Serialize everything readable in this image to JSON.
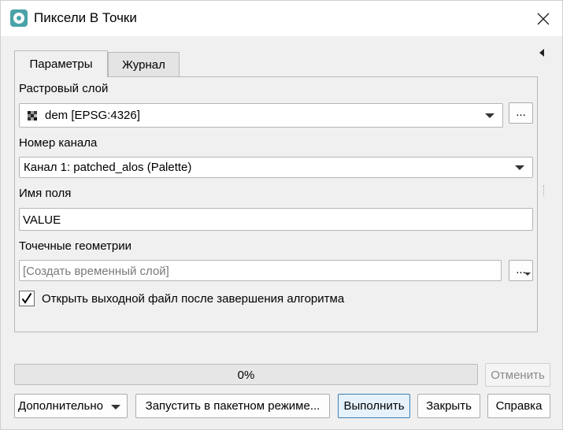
{
  "window": {
    "title": "Пиксели В Точки"
  },
  "tabs": [
    {
      "label": "Параметры",
      "active": true
    },
    {
      "label": "Журнал",
      "active": false
    }
  ],
  "params": {
    "raster_layer": {
      "label": "Растровый слой",
      "value": "dem [EPSG:4326]",
      "browse_label": "..."
    },
    "band": {
      "label": "Номер канала",
      "value": "Канал 1: patched_alos (Palette)"
    },
    "field_name": {
      "label": "Имя поля",
      "value": "VALUE"
    },
    "output": {
      "label": "Точечные геометрии",
      "placeholder": "[Создать временный слой]",
      "browse_label": "..."
    },
    "open_after": {
      "label": "Открыть выходной файл после завершения алгоритма",
      "checked": true
    }
  },
  "progress": {
    "value": 0,
    "text": "0%"
  },
  "buttons": {
    "cancel": "Отменить",
    "advanced": "Дополнительно",
    "batch": "Запустить в пакетном режиме...",
    "run": "Выполнить",
    "close": "Закрыть",
    "help": "Справка"
  },
  "colors": {
    "accent": "#3c7fb1",
    "progress_fill": "#06b025",
    "app_icon": "#4aa3a8"
  }
}
